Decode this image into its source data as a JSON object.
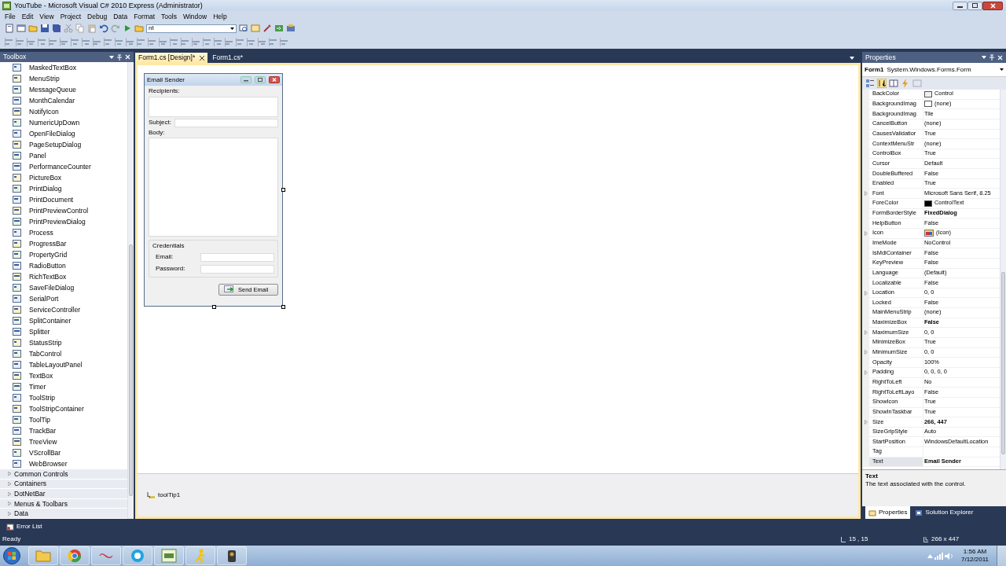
{
  "window": {
    "title": "YouTube - Microsoft Visual C# 2010 Express (Administrator)"
  },
  "menu": [
    "File",
    "Edit",
    "View",
    "Project",
    "Debug",
    "Data",
    "Format",
    "Tools",
    "Window",
    "Help"
  ],
  "toolbar": {
    "combo_value": "nt"
  },
  "toolbox": {
    "title": "Toolbox",
    "items": [
      "MaskedTextBox",
      "MenuStrip",
      "MessageQueue",
      "MonthCalendar",
      "NotifyIcon",
      "NumericUpDown",
      "OpenFileDialog",
      "PageSetupDialog",
      "Panel",
      "PerformanceCounter",
      "PictureBox",
      "PrintDialog",
      "PrintDocument",
      "PrintPreviewControl",
      "PrintPreviewDialog",
      "Process",
      "ProgressBar",
      "PropertyGrid",
      "RadioButton",
      "RichTextBox",
      "SaveFileDialog",
      "SerialPort",
      "ServiceController",
      "SplitContainer",
      "Splitter",
      "StatusStrip",
      "TabControl",
      "TableLayoutPanel",
      "TextBox",
      "Timer",
      "ToolStrip",
      "ToolStripContainer",
      "ToolTip",
      "TrackBar",
      "TreeView",
      "VScrollBar",
      "WebBrowser"
    ],
    "groups": [
      {
        "label": "Common Controls",
        "expanded": false
      },
      {
        "label": "Containers",
        "expanded": false
      },
      {
        "label": "DotNetBar",
        "expanded": false
      },
      {
        "label": "Menus & Toolbars",
        "expanded": false
      },
      {
        "label": "Data",
        "expanded": false
      }
    ]
  },
  "document_tabs": [
    {
      "label": "Form1.cs [Design]*",
      "selected": true
    },
    {
      "label": "Form1.cs*",
      "selected": false
    }
  ],
  "form": {
    "title": "Email Sender",
    "recipients_label": "Recipients:",
    "subject_label": "Subject:",
    "body_label": "Body:",
    "credentials_label": "Credentials",
    "email_label": "Email:",
    "password_label": "Password:",
    "send_button": "Send Email"
  },
  "component_tray": [
    "toolTip1"
  ],
  "properties": {
    "title": "Properties",
    "object_name": "Form1",
    "object_type": "System.Windows.Forms.Form",
    "rows": [
      {
        "name": "BackColor",
        "value": "Control",
        "kind": "color",
        "color": "#f0f0f0",
        "expandable": false,
        "bold": false,
        "selected": false
      },
      {
        "name": "BackgroundImag",
        "value": "(none)",
        "kind": "color",
        "color": "#ffffff",
        "expandable": false,
        "bold": false,
        "selected": false
      },
      {
        "name": "BackgroundImag",
        "value": "Tile",
        "kind": "text",
        "expandable": false,
        "bold": false,
        "selected": false
      },
      {
        "name": "CancelButton",
        "value": "(none)",
        "kind": "text",
        "expandable": false,
        "bold": false,
        "selected": false
      },
      {
        "name": "CausesValidatior",
        "value": "True",
        "kind": "text",
        "expandable": false,
        "bold": false,
        "selected": false
      },
      {
        "name": "ContextMenuStr",
        "value": "(none)",
        "kind": "text",
        "expandable": false,
        "bold": false,
        "selected": false
      },
      {
        "name": "ControlBox",
        "value": "True",
        "kind": "text",
        "expandable": false,
        "bold": false,
        "selected": false
      },
      {
        "name": "Cursor",
        "value": "Default",
        "kind": "text",
        "expandable": false,
        "bold": false,
        "selected": false
      },
      {
        "name": "DoubleBuffered",
        "value": "False",
        "kind": "text",
        "expandable": false,
        "bold": false,
        "selected": false
      },
      {
        "name": "Enabled",
        "value": "True",
        "kind": "text",
        "expandable": false,
        "bold": false,
        "selected": false
      },
      {
        "name": "Font",
        "value": "Microsoft Sans Serif, 8.25",
        "kind": "text",
        "expandable": true,
        "bold": false,
        "selected": false
      },
      {
        "name": "ForeColor",
        "value": "ControlText",
        "kind": "color",
        "color": "#000000",
        "expandable": false,
        "bold": false,
        "selected": false
      },
      {
        "name": "FormBorderStyle",
        "value": "FixedDialog",
        "kind": "text",
        "expandable": false,
        "bold": true,
        "selected": false
      },
      {
        "name": "HelpButton",
        "value": "False",
        "kind": "text",
        "expandable": false,
        "bold": false,
        "selected": false
      },
      {
        "name": "Icon",
        "value": "(Icon)",
        "kind": "image",
        "expandable": true,
        "bold": false,
        "selected": false
      },
      {
        "name": "ImeMode",
        "value": "NoControl",
        "kind": "text",
        "expandable": false,
        "bold": false,
        "selected": false
      },
      {
        "name": "IsMdiContainer",
        "value": "False",
        "kind": "text",
        "expandable": false,
        "bold": false,
        "selected": false
      },
      {
        "name": "KeyPreview",
        "value": "False",
        "kind": "text",
        "expandable": false,
        "bold": false,
        "selected": false
      },
      {
        "name": "Language",
        "value": "(Default)",
        "kind": "text",
        "expandable": false,
        "bold": false,
        "selected": false
      },
      {
        "name": "Localizable",
        "value": "False",
        "kind": "text",
        "expandable": false,
        "bold": false,
        "selected": false
      },
      {
        "name": "Location",
        "value": "0, 0",
        "kind": "text",
        "expandable": true,
        "bold": false,
        "selected": false
      },
      {
        "name": "Locked",
        "value": "False",
        "kind": "text",
        "expandable": false,
        "bold": false,
        "selected": false
      },
      {
        "name": "MainMenuStrip",
        "value": "(none)",
        "kind": "text",
        "expandable": false,
        "bold": false,
        "selected": false
      },
      {
        "name": "MaximizeBox",
        "value": "False",
        "kind": "text",
        "expandable": false,
        "bold": true,
        "selected": false
      },
      {
        "name": "MaximumSize",
        "value": "0, 0",
        "kind": "text",
        "expandable": true,
        "bold": false,
        "selected": false
      },
      {
        "name": "MinimizeBox",
        "value": "True",
        "kind": "text",
        "expandable": false,
        "bold": false,
        "selected": false
      },
      {
        "name": "MinimumSize",
        "value": "0, 0",
        "kind": "text",
        "expandable": true,
        "bold": false,
        "selected": false
      },
      {
        "name": "Opacity",
        "value": "100%",
        "kind": "text",
        "expandable": false,
        "bold": false,
        "selected": false
      },
      {
        "name": "Padding",
        "value": "0, 0, 0, 0",
        "kind": "text",
        "expandable": true,
        "bold": false,
        "selected": false
      },
      {
        "name": "RightToLeft",
        "value": "No",
        "kind": "text",
        "expandable": false,
        "bold": false,
        "selected": false
      },
      {
        "name": "RightToLeftLayo",
        "value": "False",
        "kind": "text",
        "expandable": false,
        "bold": false,
        "selected": false
      },
      {
        "name": "ShowIcon",
        "value": "True",
        "kind": "text",
        "expandable": false,
        "bold": false,
        "selected": false
      },
      {
        "name": "ShowInTaskbar",
        "value": "True",
        "kind": "text",
        "expandable": false,
        "bold": false,
        "selected": false
      },
      {
        "name": "Size",
        "value": "266, 447",
        "kind": "text",
        "expandable": true,
        "bold": true,
        "selected": false
      },
      {
        "name": "SizeGripStyle",
        "value": "Auto",
        "kind": "text",
        "expandable": false,
        "bold": false,
        "selected": false
      },
      {
        "name": "StartPosition",
        "value": "WindowsDefaultLocation",
        "kind": "text",
        "expandable": false,
        "bold": false,
        "selected": false
      },
      {
        "name": "Tag",
        "kind": "text",
        "expandable": false,
        "selected": false
      },
      {
        "name": "Text",
        "value": "Email Sender",
        "kind": "text",
        "expandable": false,
        "bold": true,
        "selected": true
      }
    ],
    "description_title": "Text",
    "description": "The text associated with the control."
  },
  "bottom_tabs": [
    {
      "label": "Properties",
      "selected": true
    },
    {
      "label": "Solution Explorer",
      "selected": false
    }
  ],
  "error_list_tab": "Error List",
  "status_bar": {
    "text": "Ready",
    "position": "15 , 15",
    "size": "266 x 447"
  },
  "clock": {
    "time": "1:56 AM",
    "date": "7/12/2011"
  }
}
